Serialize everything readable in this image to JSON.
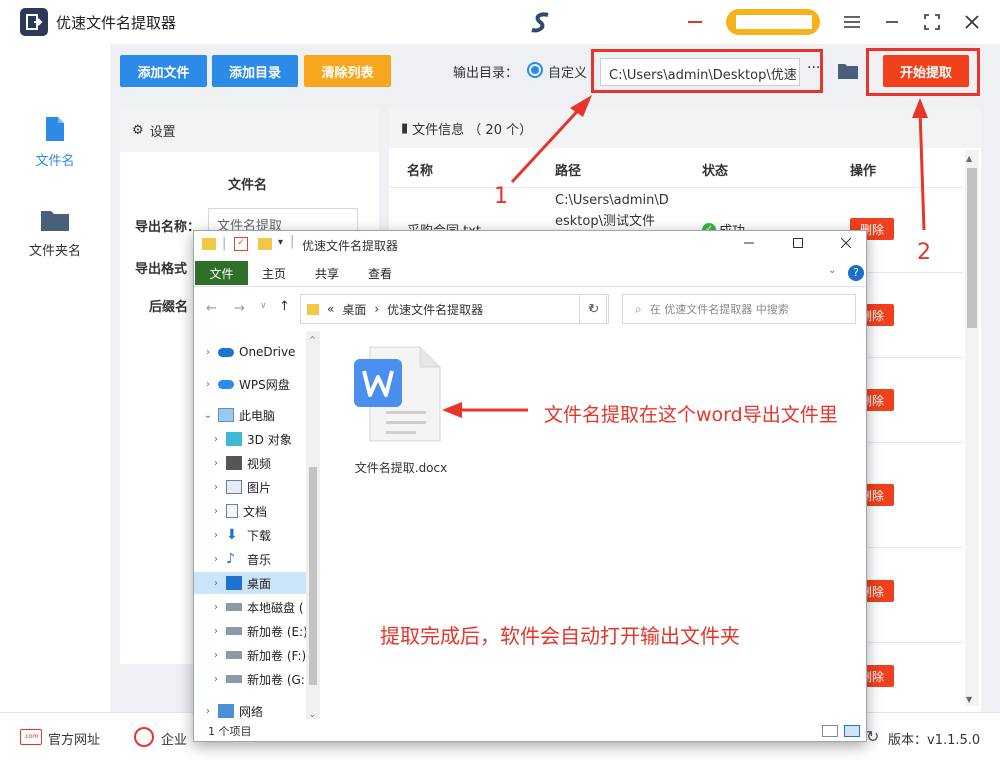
{
  "app": {
    "title": "优速文件名提取器",
    "window_controls": [
      "menu-icon",
      "minimize-icon",
      "maximize-icon",
      "close-icon"
    ]
  },
  "sidebar": {
    "items": [
      {
        "label": "文件名",
        "icon": "file-icon",
        "active": true
      },
      {
        "label": "文件夹名",
        "icon": "folder-icon",
        "active": false
      }
    ]
  },
  "toolbar": {
    "add_file": "添加文件",
    "add_dir": "添加目录",
    "clear_list": "清除列表",
    "output_label": "输出目录：",
    "radio_custom": "自定义",
    "output_path": "C:\\Users\\admin\\Desktop\\优速",
    "more": "···",
    "start": "开始提取"
  },
  "settings": {
    "header": "设置",
    "section": "文件名",
    "export_name_label": "导出名称：",
    "export_name_value": "文件名提取",
    "export_format_label": "导出格式",
    "suffix_label": "后缀名"
  },
  "file_info": {
    "header": "文件信息 （ 20 个）",
    "columns": [
      "名称",
      "路径",
      "状态",
      "操作"
    ],
    "row1": {
      "name": "采购合同.txt",
      "path_line1": "C:\\Users\\admin\\D",
      "path_line2": "esktop\\测试文件",
      "status": "成功"
    },
    "delete_label": "删除"
  },
  "explorer": {
    "title": "优速文件名提取器",
    "tabs": [
      "文件",
      "主页",
      "共享",
      "查看"
    ],
    "breadcrumb": [
      "«",
      "桌面",
      "›",
      "优速文件名提取器"
    ],
    "search_placeholder": "在 优速文件名提取器 中搜索",
    "nav": [
      {
        "label": "OneDrive",
        "icon": "cloud-icon",
        "indent": 0
      },
      {
        "label": "WPS网盘",
        "icon": "cloud-icon",
        "indent": 0
      },
      {
        "label": "此电脑",
        "icon": "computer-icon",
        "indent": 0
      },
      {
        "label": "3D 对象",
        "icon": "cube-icon",
        "indent": 1
      },
      {
        "label": "视频",
        "icon": "video-icon",
        "indent": 1
      },
      {
        "label": "图片",
        "icon": "picture-icon",
        "indent": 1
      },
      {
        "label": "文档",
        "icon": "document-icon",
        "indent": 1
      },
      {
        "label": "下载",
        "icon": "download-icon",
        "indent": 1
      },
      {
        "label": "音乐",
        "icon": "music-icon",
        "indent": 1
      },
      {
        "label": "桌面",
        "icon": "desktop-icon",
        "indent": 1
      },
      {
        "label": "本地磁盘 (",
        "icon": "drive-icon",
        "indent": 1
      },
      {
        "label": "新加卷 (E:)",
        "icon": "drive-icon",
        "indent": 1
      },
      {
        "label": "新加卷 (F:)",
        "icon": "drive-icon",
        "indent": 1
      },
      {
        "label": "新加卷 (G:)",
        "icon": "drive-icon",
        "indent": 1
      },
      {
        "label": "网络",
        "icon": "network-icon",
        "indent": 0
      }
    ],
    "file_name": "文件名提取.docx",
    "status": "1 个项目"
  },
  "annotations": {
    "num1": "1",
    "num2": "2",
    "word_note": "文件名提取在这个word导出文件里",
    "done_note": "提取完成后，软件会自动打开输出文件夹"
  },
  "bottom": {
    "website": "官方网址",
    "enterprise": "企业",
    "version": "版本：v1.1.5.0"
  },
  "colors": {
    "blue_button": "#2b8be6",
    "orange_button": "#f7a71e",
    "start_button": "#f0401c",
    "annotation_red": "#e8342a",
    "ribbon_file_tab": "#2e6f2a"
  }
}
